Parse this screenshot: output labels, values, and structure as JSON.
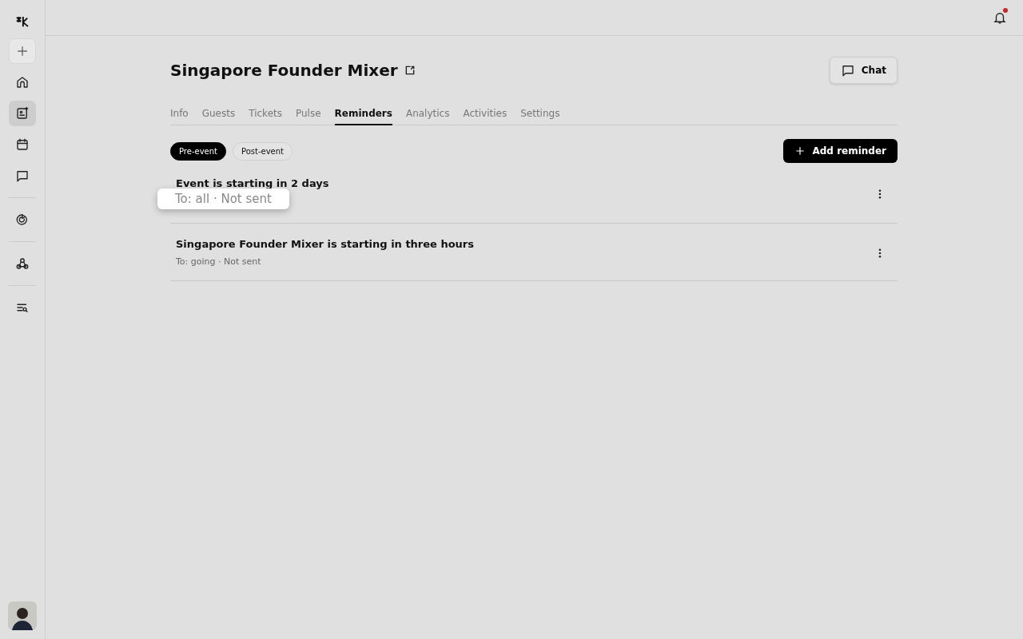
{
  "sidebar": {
    "items": [
      {
        "kind": "plus"
      },
      {
        "kind": "home",
        "selected": false
      },
      {
        "kind": "events",
        "selected": true
      },
      {
        "kind": "calendar",
        "selected": false
      },
      {
        "kind": "chat",
        "selected": false
      },
      {
        "kind": "divider"
      },
      {
        "kind": "discover",
        "selected": false
      },
      {
        "kind": "divider"
      },
      {
        "kind": "webhook",
        "selected": false
      },
      {
        "kind": "divider"
      },
      {
        "kind": "search",
        "selected": false
      }
    ]
  },
  "header": {
    "notifications_unread": true
  },
  "event": {
    "title": "Singapore Founder Mixer",
    "chat_button": "Chat"
  },
  "tabs": [
    {
      "label": "Info",
      "selected": false
    },
    {
      "label": "Guests",
      "selected": false
    },
    {
      "label": "Tickets",
      "selected": false
    },
    {
      "label": "Pulse",
      "selected": false
    },
    {
      "label": "Reminders",
      "selected": true
    },
    {
      "label": "Analytics",
      "selected": false
    },
    {
      "label": "Activities",
      "selected": false
    },
    {
      "label": "Settings",
      "selected": false
    }
  ],
  "filters": [
    {
      "label": "Pre-event",
      "selected": true
    },
    {
      "label": "Post-event",
      "selected": false
    }
  ],
  "add_button": "Add reminder",
  "reminders": [
    {
      "title": "Event is starting in 2 days",
      "detail": "To: all · Not sent",
      "highlighted": true
    },
    {
      "title": "Singapore Founder Mixer is starting in three hours",
      "detail": "To: going · Not sent",
      "highlighted": false
    }
  ]
}
